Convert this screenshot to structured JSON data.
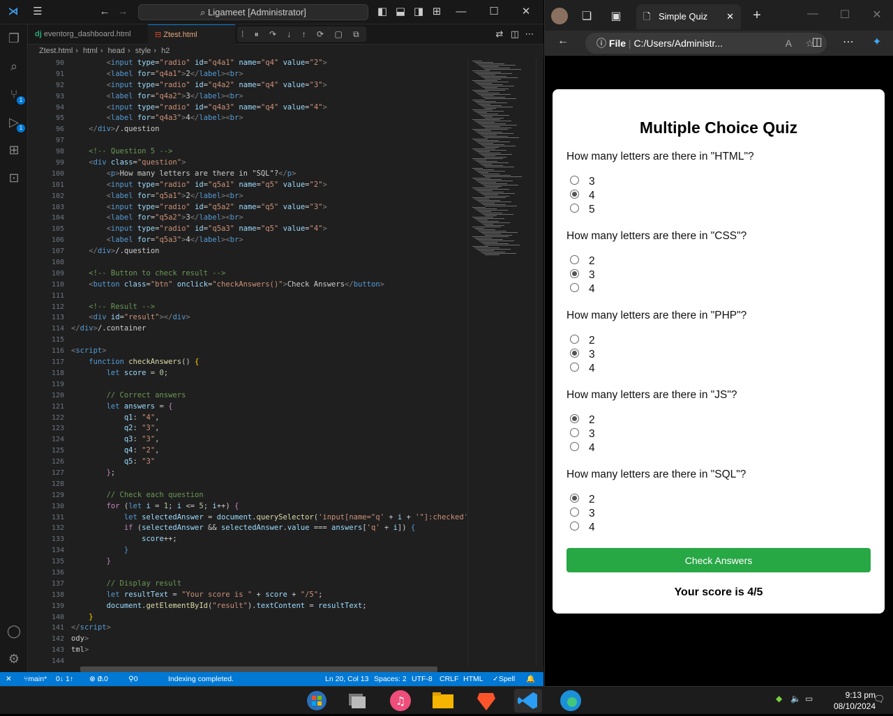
{
  "vscode": {
    "title": "Ligameet [Administrator]",
    "tabs": [
      {
        "label": "eventorg_dashboard.html",
        "icon": "django-icon"
      },
      {
        "label": "Ztest.html",
        "icon": "html-icon"
      }
    ],
    "breadcrumb": [
      "Ztest.html",
      "html",
      "head",
      "style",
      "h2"
    ],
    "status": {
      "branch": "main*",
      "sync": "0↓ 1↑",
      "problems": "0",
      "warnings": "0",
      "ports": "0",
      "message": "Indexing completed.",
      "position": "Ln 20, Col 13",
      "spaces": "Spaces: 2",
      "encoding": "UTF-8",
      "eol": "CRLF",
      "language": "HTML",
      "spell": "Spell"
    },
    "badges": {
      "scm": "1",
      "debug": "1"
    },
    "line_numbers": [
      "90",
      "91",
      "92",
      "93",
      "94",
      "95",
      "96",
      "97",
      "98",
      "99",
      "100",
      "101",
      "102",
      "103",
      "104",
      "105",
      "106",
      "107",
      "108",
      "109",
      "110",
      "111",
      "112",
      "113",
      "114",
      "115",
      "116",
      "117",
      "118",
      "119",
      "120",
      "121",
      "122",
      "123",
      "124",
      "125",
      "126",
      "127",
      "128",
      "129",
      "130",
      "131",
      "132",
      "133",
      "134",
      "135",
      "136",
      "137",
      "138",
      "139",
      "140",
      "141",
      "142",
      "143",
      "144"
    ]
  },
  "browser": {
    "tab_title": "Simple Quiz",
    "address_label": "File",
    "address": "C:/Users/Administr...",
    "quiz": {
      "title": "Multiple Choice Quiz",
      "questions": [
        {
          "text": "How many letters are there in \"HTML\"?",
          "options": [
            "3",
            "4",
            "5"
          ],
          "selected": 1
        },
        {
          "text": "How many letters are there in \"CSS\"?",
          "options": [
            "2",
            "3",
            "4"
          ],
          "selected": 1
        },
        {
          "text": "How many letters are there in \"PHP\"?",
          "options": [
            "2",
            "3",
            "4"
          ],
          "selected": 1
        },
        {
          "text": "How many letters are there in \"JS\"?",
          "options": [
            "2",
            "3",
            "4"
          ],
          "selected": 0
        },
        {
          "text": "How many letters are there in \"SQL\"?",
          "options": [
            "2",
            "3",
            "4"
          ],
          "selected": 0
        }
      ],
      "button": "Check Answers",
      "result": "Your score is 4/5"
    }
  },
  "taskbar": {
    "time": "9:13 pm",
    "date": "08/10/2024"
  }
}
